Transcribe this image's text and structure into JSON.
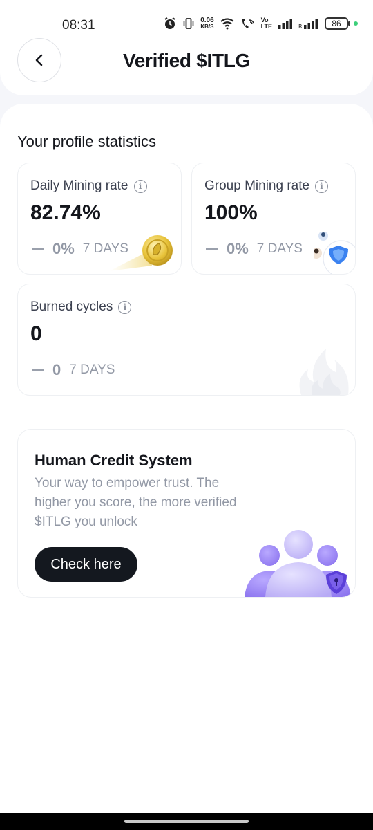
{
  "status_bar": {
    "time": "08:31",
    "net_speed_value": "0.06",
    "net_speed_unit": "KB/S",
    "volte_top": "Vo",
    "volte_bottom": "LTE",
    "battery": "86",
    "icons": [
      "alarm-icon",
      "vibrate-icon",
      "wifi-icon",
      "wifi-call-icon",
      "signal-icon",
      "signal-roaming-icon",
      "battery-icon"
    ]
  },
  "header": {
    "title": "Verified $ITLG",
    "back_icon": "chevron-left-icon"
  },
  "section_title": "Your profile statistics",
  "stats": {
    "daily": {
      "label": "Daily Mining rate",
      "value": "82.74%",
      "trend_pct": "0%",
      "period": "7 DAYS"
    },
    "group": {
      "label": "Group Mining rate",
      "value": "100%",
      "trend_pct": "0%",
      "period": "7 DAYS"
    },
    "burned": {
      "label": "Burned cycles",
      "value": "0",
      "trend_pct": "0",
      "period": "7 DAYS"
    }
  },
  "hcs": {
    "title": "Human Credit System",
    "description": "Your way to empower trust. The higher you score, the more verified $ITLG you unlock",
    "button": "Check here"
  },
  "colors": {
    "accent_dark": "#14181f",
    "muted_text": "#9298a5",
    "coin_gold": "#e3bb2b",
    "people_purple": "#9a86f0",
    "shield_blue": "#2f7cf0",
    "status_dot": "#3ccf7a"
  }
}
